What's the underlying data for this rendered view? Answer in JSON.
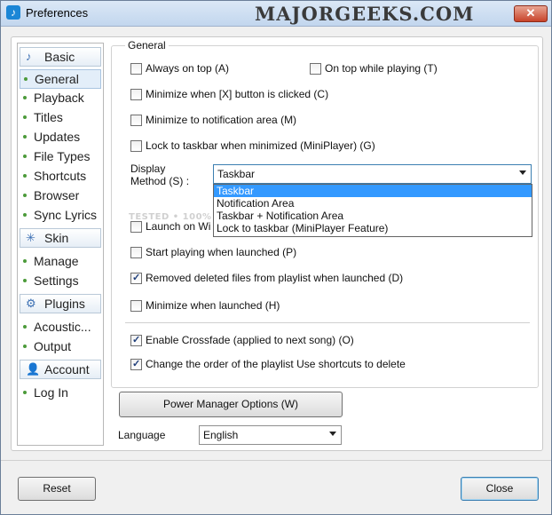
{
  "window": {
    "title": "Preferences",
    "watermark": "MAJORGEEKS.COM",
    "close_glyph": "✕"
  },
  "sidebar": {
    "sections": [
      {
        "label": "Basic",
        "icon": "music-note-icon",
        "glyph": "♪"
      },
      {
        "label": "Skin",
        "icon": "sparkle-icon",
        "glyph": "✳"
      },
      {
        "label": "Plugins",
        "icon": "gear-icon",
        "glyph": "⚙"
      },
      {
        "label": "Account",
        "icon": "user-icon",
        "glyph": "👤"
      }
    ],
    "items": [
      {
        "label": "General",
        "selected": true
      },
      {
        "label": "Playback"
      },
      {
        "label": "Titles"
      },
      {
        "label": "Updates"
      },
      {
        "label": "File Types"
      },
      {
        "label": "Shortcuts"
      },
      {
        "label": "Browser"
      },
      {
        "label": "Sync Lyrics"
      },
      {
        "label": "Manage"
      },
      {
        "label": "Settings"
      },
      {
        "label": "Acoustic..."
      },
      {
        "label": "Output"
      },
      {
        "label": "Log In"
      }
    ]
  },
  "general": {
    "group_title": "General",
    "always_on_top": {
      "label": "Always on top (A)",
      "checked": false
    },
    "on_top_while_playing": {
      "label": "On top while playing (T)",
      "checked": false
    },
    "minimize_when_x": {
      "label": "Minimize when [X] button is clicked (C)",
      "checked": false
    },
    "minimize_to_notification": {
      "label": "Minimize to notification area (M)",
      "checked": false
    },
    "lock_to_taskbar": {
      "label": "Lock to taskbar when minimized (MiniPlayer) (G)",
      "checked": false
    },
    "display_method": {
      "label": "Display Method (S) :",
      "value": "Taskbar",
      "options": [
        "Taskbar",
        "Notification Area",
        "Taskbar + Notification Area",
        "Lock to taskbar (MiniPlayer Feature)"
      ],
      "highlighted": "Taskbar"
    },
    "launch_on_windows": {
      "label": "Launch on Wi",
      "checked": false
    },
    "start_playing": {
      "label": "Start playing when launched (P)",
      "checked": false
    },
    "remove_deleted": {
      "label": "Removed deleted files from playlist when launched (D)",
      "checked": true
    },
    "minimize_when_launched": {
      "label": "Minimize when launched (H)",
      "checked": false
    },
    "enable_crossfade": {
      "label": "Enable Crossfade (applied to next song) (O)",
      "checked": true
    },
    "change_order": {
      "label": "Change the order of the playlist  Use shortcuts to delete",
      "checked": true
    },
    "overlay_watermark": "TESTED • 100% CLEAN • MAJORGEEKS"
  },
  "power_manager_button": "Power Manager Options (W)",
  "language": {
    "label": "Language",
    "value": "English"
  },
  "footer": {
    "reset": "Reset",
    "close": "Close"
  },
  "colors": {
    "highlight": "#3399ff",
    "title_close": "#c8432a",
    "accent_dot": "#4c9b3a"
  }
}
